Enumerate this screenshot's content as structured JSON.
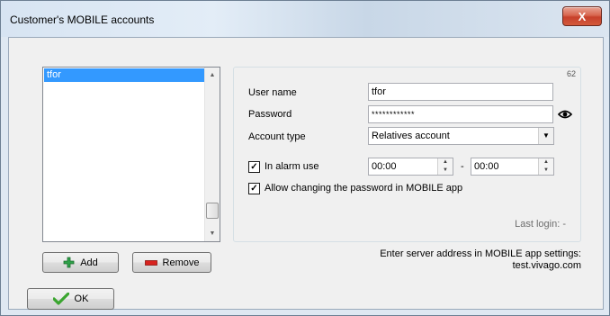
{
  "window": {
    "title": "Customer's MOBILE accounts",
    "close_label": "X"
  },
  "accounts_list": {
    "items": [
      "tfor"
    ]
  },
  "buttons": {
    "add_label": "Add",
    "remove_label": "Remove",
    "ok_label": "OK"
  },
  "details": {
    "id_badge": "62",
    "username_label": "User name",
    "username_value": "tfor",
    "password_label": "Password",
    "password_value": "************",
    "account_type_label": "Account type",
    "account_type_value": "Relatives account",
    "alarm_use_label": "In alarm use",
    "alarm_use_checked": true,
    "alarm_from": "00:00",
    "alarm_separator": "-",
    "alarm_to": "00:00",
    "allow_change_label": "Allow changing the password in MOBILE app",
    "allow_change_checked": true,
    "last_login": "Last login: -"
  },
  "server_info": {
    "line1": "Enter server address in MOBILE app settings:",
    "line2": "test.vivago.com"
  },
  "icons": {
    "add": "plus-icon",
    "remove": "minus-icon",
    "ok": "checkmark-icon",
    "show_password": "eye-icon"
  },
  "colors": {
    "selection": "#3399ff",
    "add_icon": "#2fa24a",
    "remove_icon": "#d8231f",
    "ok_icon": "#3aa52f",
    "close_button": "#c7402b"
  }
}
